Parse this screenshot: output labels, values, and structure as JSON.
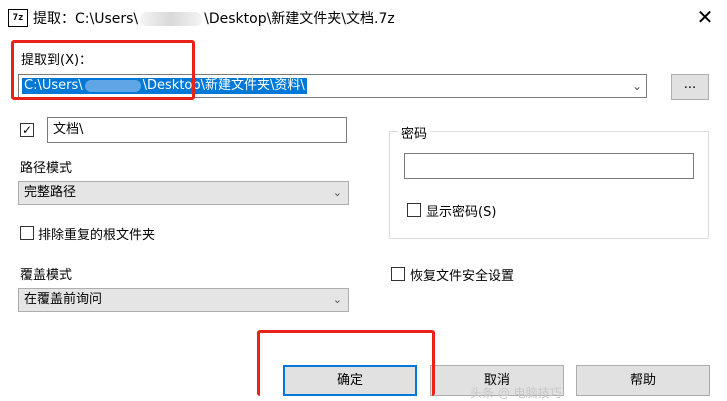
{
  "window": {
    "icon_text": "7z",
    "title_prefix": "提取：C:\\Users\\",
    "title_suffix": "\\Desktop\\新建文件夹\\文档.7z",
    "close_label": "✕"
  },
  "extract_to": {
    "label": "提取到(X)：",
    "path_prefix": "C:\\Users\\",
    "path_suffix": "\\Desktop\\新建文件夹\\资料\\",
    "browse_label": "..."
  },
  "subfolder": {
    "checked": true,
    "value": "文档\\"
  },
  "path_mode": {
    "label": "路径模式",
    "selected": "完整路径"
  },
  "eliminate_duplicates": {
    "label": "排除重复的根文件夹",
    "checked": false
  },
  "overwrite_mode": {
    "label": "覆盖模式",
    "selected": "在覆盖前询问"
  },
  "password": {
    "label": "密码",
    "value": "",
    "show_password_label": "显示密码(S)",
    "show_password_checked": false
  },
  "restore_security": {
    "label": "恢复文件安全设置",
    "checked": false
  },
  "buttons": {
    "ok": "确定",
    "cancel": "取消",
    "help": "帮助"
  },
  "colors": {
    "highlight_box": "#e8211a",
    "selection": "#0078d7",
    "default_button_border": "#0078d7"
  },
  "watermark_text": "头条 @ 电脑技巧"
}
